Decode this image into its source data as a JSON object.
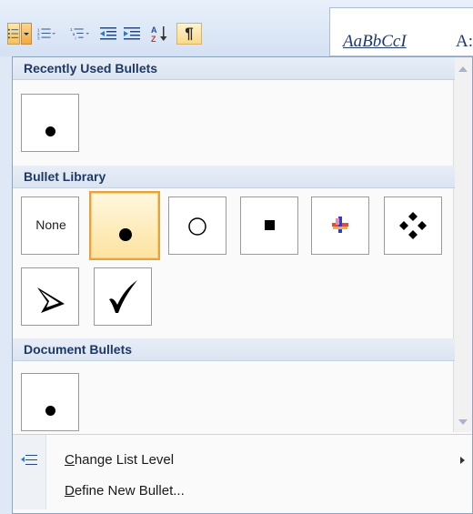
{
  "ribbon": {
    "tools": [
      {
        "name": "bullets-button",
        "icon": "bullets-icon"
      },
      {
        "name": "bullets-dropdown-arrow",
        "icon": "chevron-down-icon"
      },
      {
        "name": "numbering-button",
        "icon": "numbering-icon"
      },
      {
        "name": "multilevel-list-button",
        "icon": "multilevel-list-icon"
      },
      {
        "name": "decrease-indent-button",
        "icon": "decrease-indent-icon"
      },
      {
        "name": "increase-indent-button",
        "icon": "increase-indent-icon"
      },
      {
        "name": "sort-button",
        "icon": "sort-icon"
      },
      {
        "name": "show-hide-button",
        "icon": "pilcrow-icon",
        "glyph": "¶"
      }
    ],
    "styles_preview_1": "AaBbCcI",
    "styles_preview_2": "A:"
  },
  "panel": {
    "recent_header": "Recently Used Bullets",
    "library_header": "Bullet Library",
    "document_header": "Document Bullets",
    "none_label": "None",
    "library_items": [
      {
        "name": "bullet-none",
        "label": "None"
      },
      {
        "name": "bullet-filled-circle",
        "icon": "filled-circle-icon",
        "selected": true
      },
      {
        "name": "bullet-hollow-circle",
        "icon": "hollow-circle-icon"
      },
      {
        "name": "bullet-filled-square",
        "icon": "filled-square-icon"
      },
      {
        "name": "bullet-picture",
        "icon": "picture-bullet-icon"
      },
      {
        "name": "bullet-diamond",
        "icon": "four-diamond-icon"
      },
      {
        "name": "bullet-arrowhead",
        "icon": "arrowhead-icon"
      },
      {
        "name": "bullet-checkmark",
        "icon": "checkmark-icon"
      }
    ],
    "menu": {
      "change_level": "Change List Level",
      "define_new": "Define New Bullet..."
    },
    "colors": {
      "section_header_text": "#1e3a64",
      "selected_tile_border": "#e6a23c",
      "selected_tile_fill": "#fde3a0"
    }
  }
}
